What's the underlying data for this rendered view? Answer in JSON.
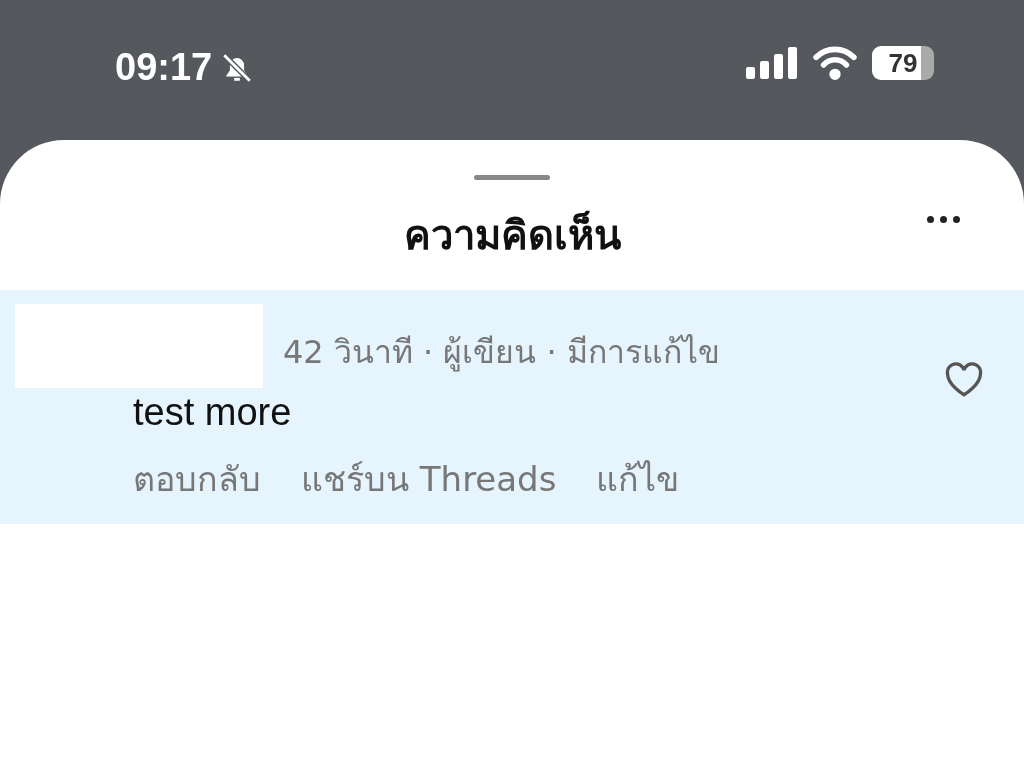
{
  "status_bar": {
    "time": "09:17",
    "battery": "79",
    "silenced": true
  },
  "sheet": {
    "title": "ความคิดเห็น"
  },
  "comment": {
    "meta": "42 วินาที · ผู้เขียน · มีการแก้ไข",
    "text": "test more",
    "liked": false,
    "highlighted": true,
    "actions": [
      "ตอบกลับ",
      "แชร์บน Threads",
      "แก้ไข"
    ]
  }
}
